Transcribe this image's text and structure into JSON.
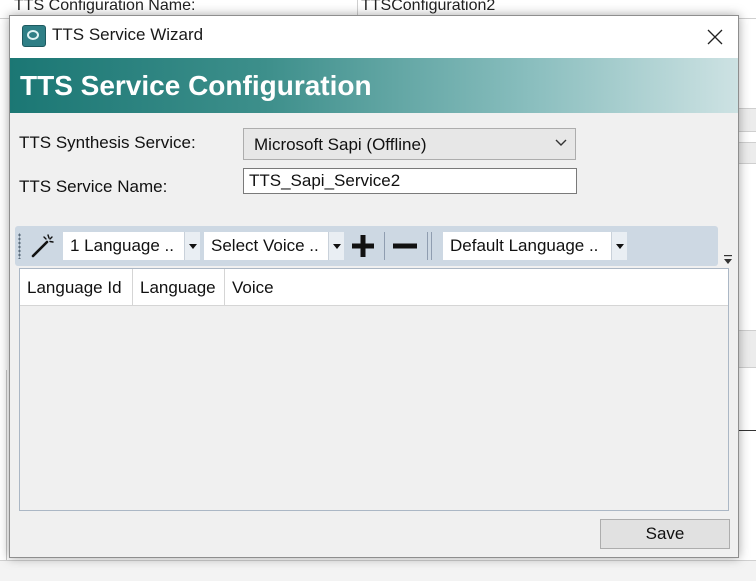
{
  "background": {
    "row_label": "TTS Configuration Name:",
    "row_value": "TTSConfiguration2"
  },
  "dialog": {
    "title": "TTS Service Wizard",
    "banner_title": "TTS Service Configuration",
    "synthesis_label": "TTS Synthesis Service:",
    "synthesis_value": "Microsoft Sapi (Offline)",
    "service_name_label": "TTS Service Name:",
    "service_name_value": "TTS_Sapi_Service2",
    "save_label": "Save"
  },
  "toolbar": {
    "language_count": "1 Language ..",
    "select_voice": "Select Voice ..",
    "default_language": "Default Language ..",
    "icons": [
      "wand-icon",
      "plus-icon",
      "minus-icon"
    ]
  },
  "grid": {
    "columns": [
      "Language Id",
      "Language",
      "Voice"
    ],
    "rows": []
  },
  "colors": {
    "banner_start": "#1b7774",
    "banner_end": "#cde2e3",
    "toolbar_bg": "#cdd8e3",
    "dialog_bg": "#f0f0f0"
  }
}
